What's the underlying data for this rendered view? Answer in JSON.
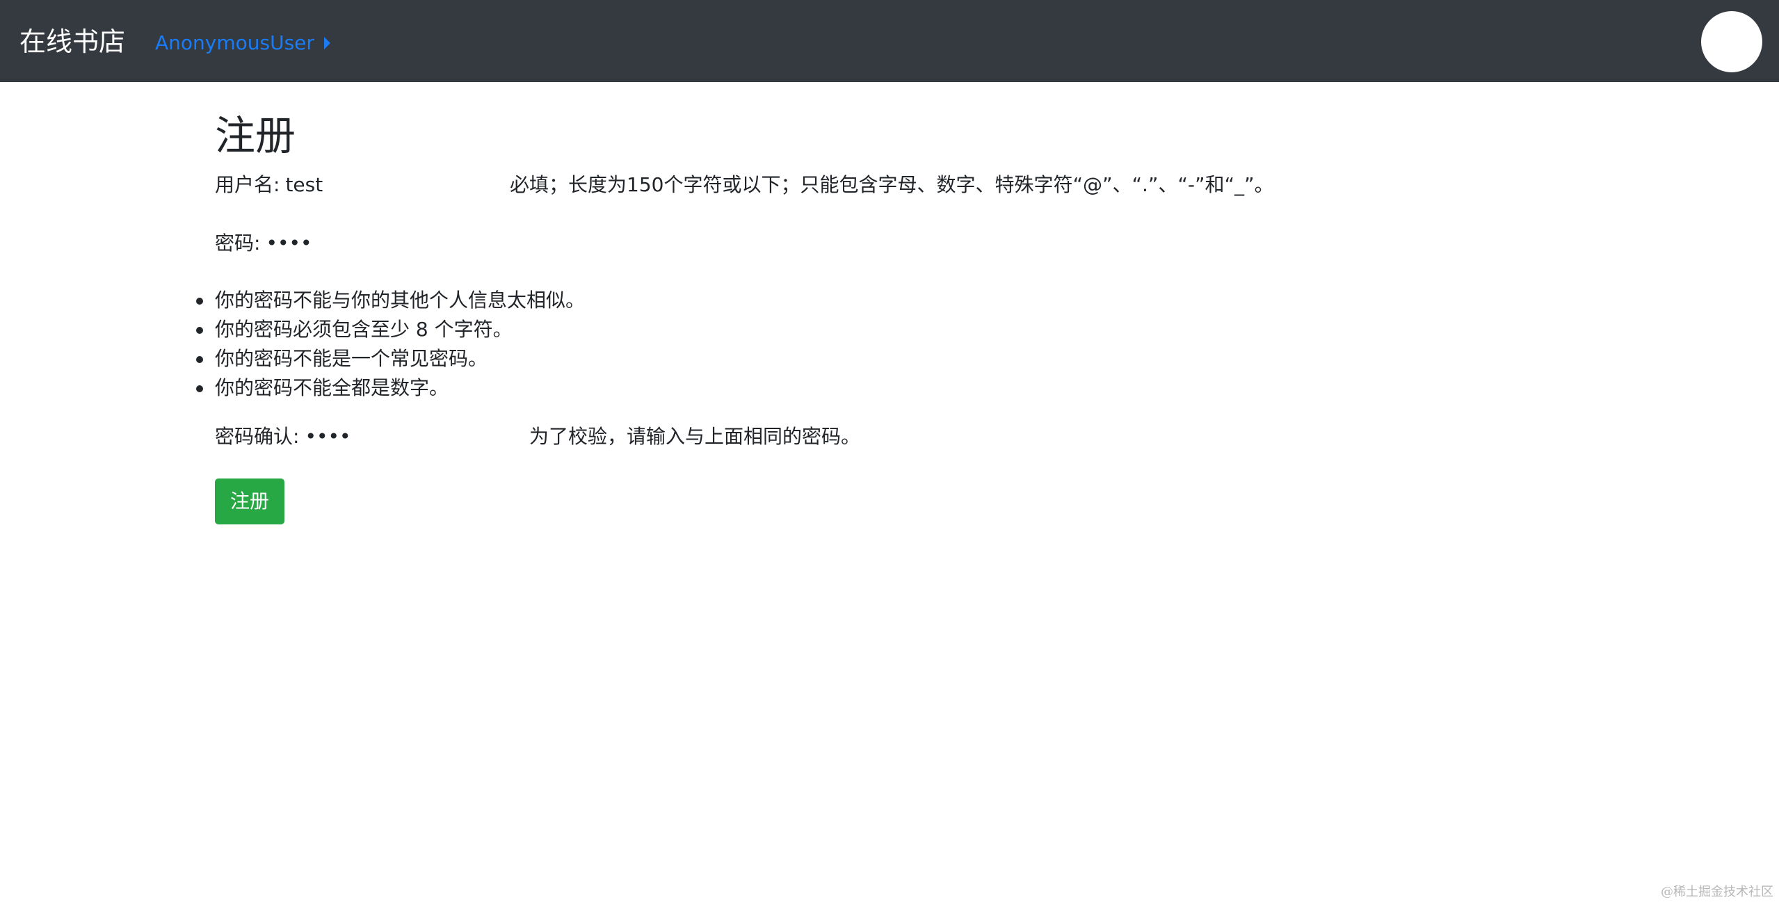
{
  "navbar": {
    "brand": "在线书店",
    "user_link": "AnonymousUser",
    "user_caret_icon": "caret-right-icon",
    "avatar_icon": "avatar-circle"
  },
  "form": {
    "title": "注册",
    "username": {
      "label": "用户名:",
      "value": "test",
      "help": "必填；长度为150个字符或以下；只能包含字母、数字、特殊字符“@”、“.”、“-”和“_”。"
    },
    "password": {
      "label": "密码:",
      "value": "test",
      "rules": [
        "你的密码不能与你的其他个人信息太相似。",
        "你的密码必须包含至少 8 个字符。",
        "你的密码不能是一个常见密码。",
        "你的密码不能全都是数字。"
      ]
    },
    "password_confirm": {
      "label": "密码确认:",
      "value": "test",
      "help": "为了校验，请输入与上面相同的密码。"
    },
    "submit_label": "注册"
  },
  "colors": {
    "navbar_bg": "#343a40",
    "link": "#1a7cf5",
    "submit_bg": "#28a745"
  },
  "watermark": "@稀土掘金技术社区"
}
